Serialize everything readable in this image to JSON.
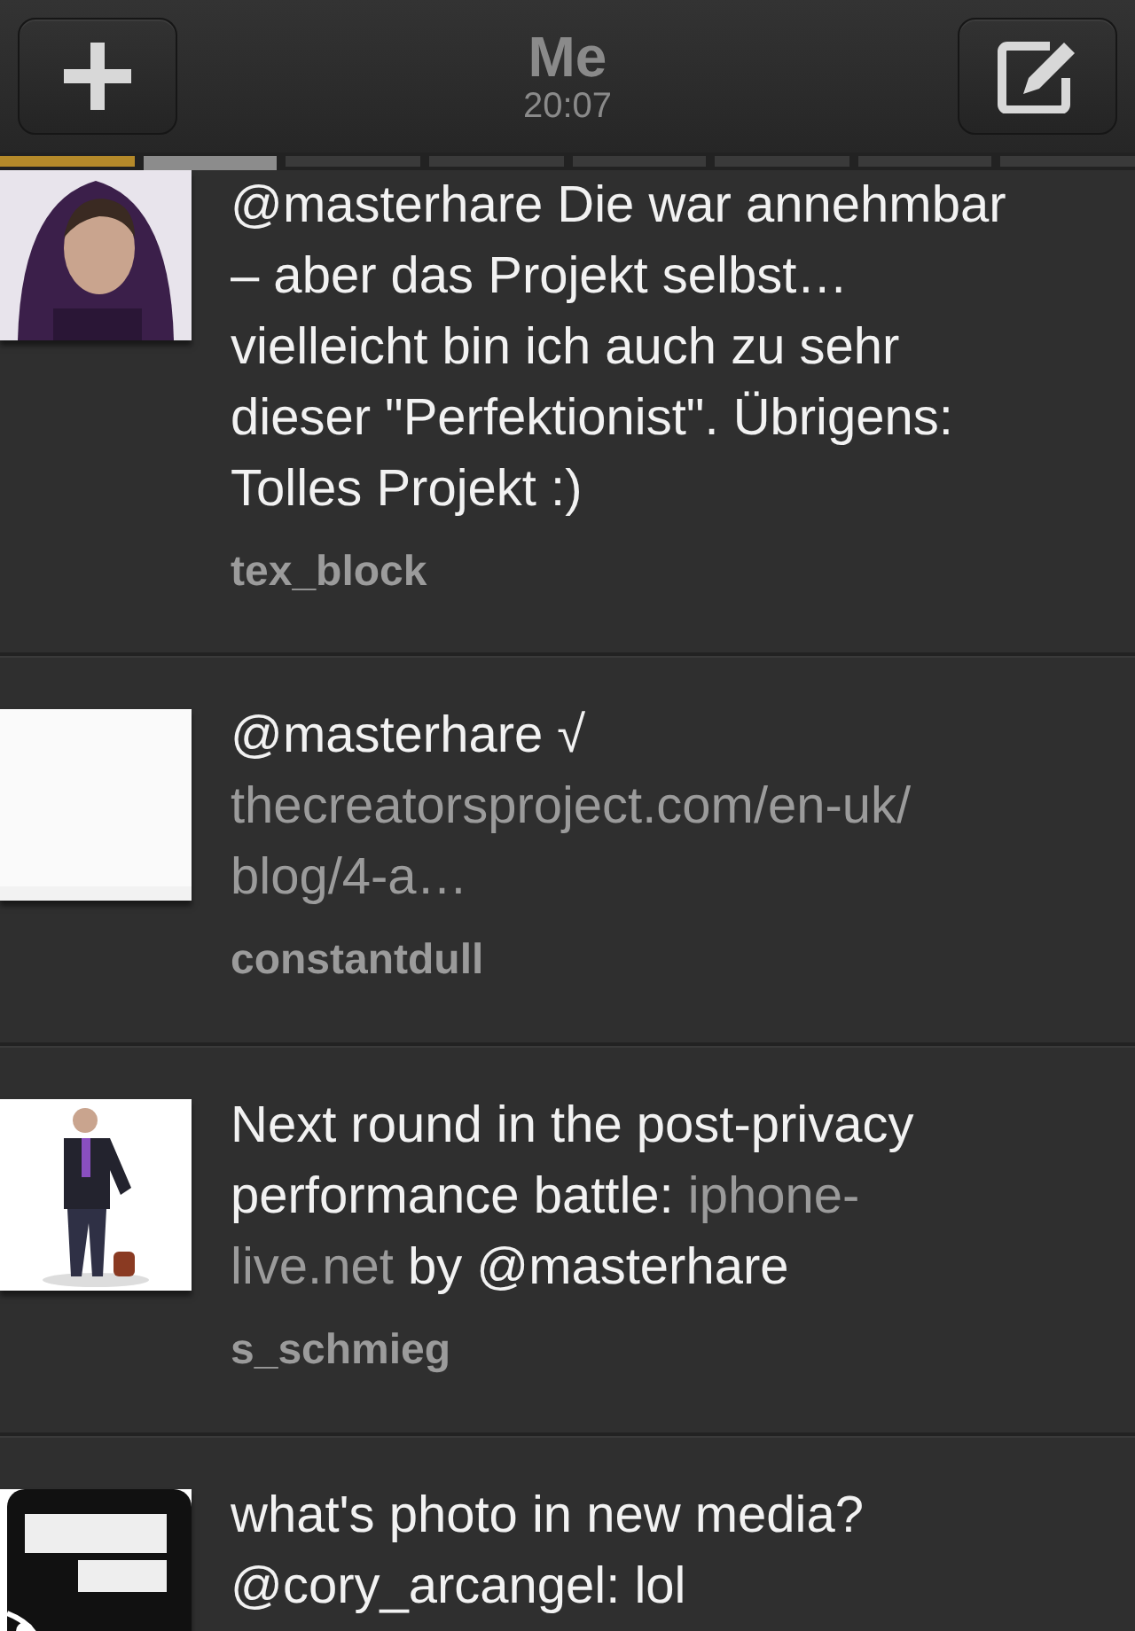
{
  "header": {
    "title": "Me",
    "time": "20:07"
  },
  "pages": [
    {
      "color": "#b58a2a",
      "selected": false
    },
    {
      "color": "#8c8c8c",
      "selected": true
    },
    {
      "color": "#3a3a3a",
      "selected": false
    },
    {
      "color": "#3a3a3a",
      "selected": false
    },
    {
      "color": "#3a3a3a",
      "selected": false
    },
    {
      "color": "#3a3a3a",
      "selected": false
    },
    {
      "color": "#3a3a3a",
      "selected": false
    },
    {
      "color": "#3a3a3a",
      "selected": false
    }
  ],
  "tweets": [
    {
      "lines": [
        [
          {
            "text": "@masterhare Die war annehmbar",
            "link": false
          }
        ],
        [
          {
            "text": "– aber das Projekt selbst…",
            "link": false
          }
        ],
        [
          {
            "text": "vielleicht bin ich auch zu sehr",
            "link": false
          }
        ],
        [
          {
            "text": "dieser \"Perfektionist\". Übrigens:",
            "link": false
          }
        ],
        [
          {
            "text": "Tolles Projekt :)",
            "link": false
          }
        ]
      ],
      "user": "tex_block"
    },
    {
      "lines": [
        [
          {
            "text": "@masterhare √",
            "link": false
          }
        ],
        [
          {
            "text": "thecreatorsproject.com/en-uk/",
            "link": true
          }
        ],
        [
          {
            "text": "blog/4-a…",
            "link": true
          }
        ]
      ],
      "user": "constantdull"
    },
    {
      "lines": [
        [
          {
            "text": "Next round in the post-privacy",
            "link": false
          }
        ],
        [
          {
            "text": "performance battle: ",
            "link": false
          },
          {
            "text": "iphone-",
            "link": true
          }
        ],
        [
          {
            "text": "live.net",
            "link": true
          },
          {
            "text": " by @masterhare",
            "link": false
          }
        ]
      ],
      "user": "s_schmieg"
    },
    {
      "lines": [
        [
          {
            "text": "what's photo in new media?",
            "link": false
          }
        ],
        [
          {
            "text": "@cory_arcangel: lol",
            "link": false
          }
        ]
      ]
    }
  ]
}
